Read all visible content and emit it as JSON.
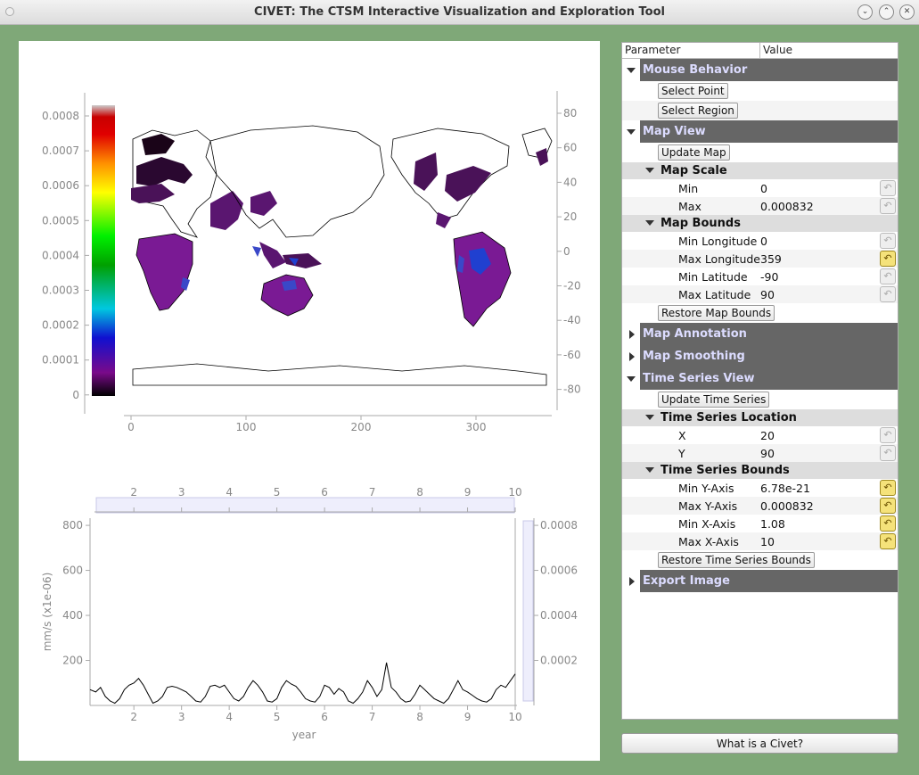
{
  "window": {
    "title": "CIVET: The CTSM Interactive Visualization and Exploration Tool"
  },
  "tree": {
    "col_parameter": "Parameter",
    "col_value": "Value",
    "mouse_behavior": {
      "label": "Mouse Behavior",
      "select_point": "Select Point",
      "select_region": "Select Region"
    },
    "map_view": {
      "label": "Map View",
      "update_map": "Update Map",
      "map_scale": {
        "label": "Map Scale",
        "min_label": "Min",
        "min_value": "0",
        "max_label": "Max",
        "max_value": "0.000832"
      },
      "map_bounds": {
        "label": "Map Bounds",
        "min_lon_label": "Min Longitude",
        "min_lon_value": "0",
        "max_lon_label": "Max Longitude",
        "max_lon_value": "359",
        "min_lat_label": "Min Latitude",
        "min_lat_value": "-90",
        "max_lat_label": "Max Latitude",
        "max_lat_value": "90"
      },
      "restore_map_bounds": "Restore Map Bounds"
    },
    "map_annotation": {
      "label": "Map Annotation"
    },
    "map_smoothing": {
      "label": "Map Smoothing"
    },
    "time_series_view": {
      "label": "Time Series View",
      "update_time_series": "Update Time Series",
      "location": {
        "label": "Time Series Location",
        "x_label": "X",
        "x_value": "20",
        "y_label": "Y",
        "y_value": "90"
      },
      "bounds": {
        "label": "Time Series Bounds",
        "min_y_label": "Min Y-Axis",
        "min_y_value": "6.78e-21",
        "max_y_label": "Max Y-Axis",
        "max_y_value": "0.000832",
        "min_x_label": "Min X-Axis",
        "min_x_value": "1.08",
        "max_x_label": "Max X-Axis",
        "max_x_value": "10"
      },
      "restore_bounds": "Restore Time Series Bounds"
    },
    "export_image": {
      "label": "Export Image"
    }
  },
  "civet_button": "What is a Civet?",
  "map": {
    "colorbar_ticks": [
      "0.0008",
      "0.0007",
      "0.0006",
      "0.0005",
      "0.0004",
      "0.0003",
      "0.0002",
      "0.0001",
      "0"
    ],
    "x_ticks": [
      "0",
      "100",
      "200",
      "300"
    ],
    "y_ticks": [
      "80",
      "60",
      "40",
      "20",
      "0",
      "-20",
      "-40",
      "-60",
      "-80"
    ]
  },
  "chart_data": {
    "type": "line",
    "xlabel": "year",
    "ylabel": "mm/s (x1e-06)",
    "xlim": [
      1.08,
      10
    ],
    "ylim": [
      0,
      832
    ],
    "x_ticks": [
      "2",
      "3",
      "4",
      "5",
      "6",
      "7",
      "8",
      "9",
      "10"
    ],
    "y_ticks": [
      "800",
      "600",
      "400",
      "200"
    ],
    "right_ticks": [
      "0.0008",
      "0.0006",
      "0.0004",
      "0.0002"
    ],
    "x": [
      1.08,
      1.2,
      1.3,
      1.4,
      1.5,
      1.6,
      1.7,
      1.8,
      1.9,
      2.0,
      2.1,
      2.2,
      2.3,
      2.4,
      2.5,
      2.6,
      2.7,
      2.8,
      2.9,
      3.0,
      3.1,
      3.2,
      3.3,
      3.4,
      3.5,
      3.6,
      3.7,
      3.8,
      3.9,
      4.0,
      4.1,
      4.2,
      4.3,
      4.4,
      4.5,
      4.6,
      4.7,
      4.8,
      4.9,
      5.0,
      5.1,
      5.2,
      5.3,
      5.4,
      5.5,
      5.6,
      5.7,
      5.8,
      5.9,
      6.0,
      6.1,
      6.2,
      6.3,
      6.4,
      6.5,
      6.6,
      6.7,
      6.8,
      6.9,
      7.0,
      7.1,
      7.2,
      7.3,
      7.4,
      7.5,
      7.6,
      7.7,
      7.8,
      7.9,
      8.0,
      8.1,
      8.2,
      8.3,
      8.4,
      8.5,
      8.6,
      8.7,
      8.8,
      8.9,
      9.0,
      9.1,
      9.2,
      9.3,
      9.4,
      9.5,
      9.6,
      9.7,
      9.8,
      9.9,
      10.0
    ],
    "y": [
      70,
      60,
      80,
      40,
      20,
      10,
      30,
      70,
      90,
      100,
      120,
      90,
      50,
      10,
      20,
      40,
      80,
      85,
      80,
      70,
      60,
      40,
      20,
      15,
      40,
      85,
      90,
      80,
      90,
      60,
      30,
      20,
      40,
      80,
      110,
      90,
      60,
      20,
      15,
      30,
      80,
      110,
      95,
      85,
      60,
      30,
      20,
      15,
      40,
      90,
      80,
      50,
      75,
      60,
      20,
      10,
      30,
      60,
      110,
      80,
      40,
      70,
      190,
      80,
      60,
      30,
      15,
      20,
      50,
      90,
      70,
      50,
      30,
      20,
      10,
      30,
      70,
      110,
      70,
      60,
      45,
      30,
      20,
      15,
      30,
      70,
      90,
      80,
      110,
      140
    ]
  }
}
